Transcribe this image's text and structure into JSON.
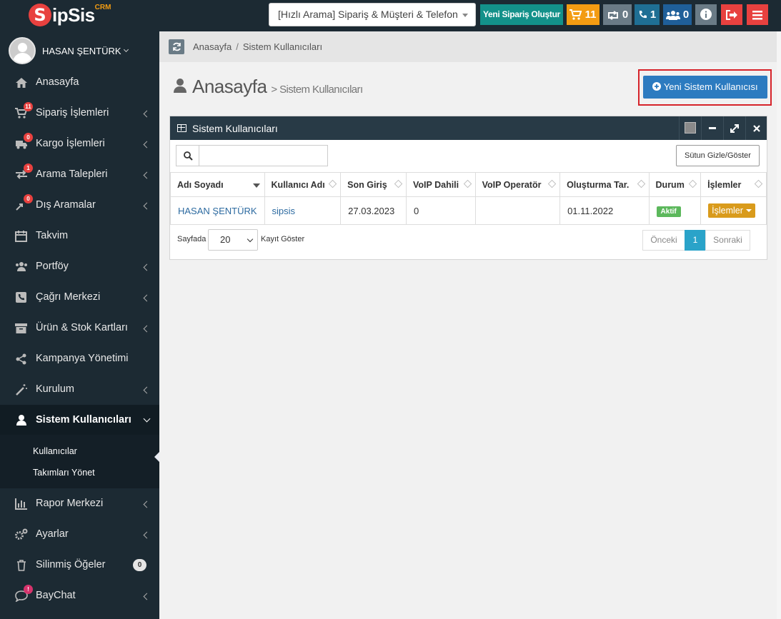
{
  "app": {
    "logo_letter": "S",
    "logo_text": "ipSis",
    "logo_sup": "CRM"
  },
  "topbar": {
    "quick_search": "[Hızlı Arama] Sipariş & Müşteri & Telefon",
    "new_order_label": "Yeni Sipariş Oluştur",
    "cart_count": "11",
    "transfer_count": "0",
    "phone_count": "1",
    "users_count": "0",
    "colors": {
      "orange": "#f39c12",
      "gray": "#6a7b86",
      "teal": "#13918a",
      "blue": "#1f5f99",
      "red": "#e8413f"
    }
  },
  "user": {
    "name": "HASAN ŞENTÜRK"
  },
  "sidebar": {
    "items": [
      {
        "label": "Anasayfa",
        "icon": "home-icon"
      },
      {
        "label": "Sipariş İşlemleri",
        "icon": "cart-icon",
        "badge": "11"
      },
      {
        "label": "Kargo İşlemleri",
        "icon": "truck-icon",
        "badge": "0"
      },
      {
        "label": "Arama Talepleri",
        "icon": "exchange-icon",
        "badge": "1"
      },
      {
        "label": "Dış Aramalar",
        "icon": "outgoing-call-icon",
        "badge": "0"
      },
      {
        "label": "Takvim",
        "icon": "calendar-icon"
      },
      {
        "label": "Portföy",
        "icon": "group-icon"
      },
      {
        "label": "Çağrı Merkezi",
        "icon": "phone-square-icon"
      },
      {
        "label": "Ürün & Stok Kartları",
        "icon": "archive-icon"
      },
      {
        "label": "Kampanya Yönetimi",
        "icon": "share-icon"
      },
      {
        "label": "Kurulum",
        "icon": "magic-wand-icon"
      },
      {
        "label": "Sistem Kullanıcıları",
        "icon": "user-icon"
      },
      {
        "label": "Rapor Merkezi",
        "icon": "bar-chart-icon"
      },
      {
        "label": "Ayarlar",
        "icon": "gears-icon"
      },
      {
        "label": "Silinmiş Öğeler",
        "icon": "trash-icon",
        "count": "0"
      },
      {
        "label": "BayChat",
        "icon": "chat-icon",
        "badge": "!"
      }
    ],
    "submenu": [
      "Kullanıcılar",
      "Takımları Yönet"
    ]
  },
  "breadcrumb": {
    "home": "Anasayfa",
    "sep": "/",
    "current": "Sistem Kullanıcıları"
  },
  "page": {
    "title": "Anasayfa",
    "subtitle": "> Sistem Kullanıcıları",
    "add_button": "Yeni Sistem Kullanıcısı"
  },
  "portlet": {
    "title": "Sistem Kullanıcıları",
    "search_value": "",
    "columns_button": "Sütun Gizle/Göster",
    "columns": [
      "Adı Soyadı",
      "Kullanıcı Adı",
      "Son Giriş",
      "VoIP Dahili",
      "VoIP Operatör",
      "Oluşturma Tar.",
      "Durum",
      "İşlemler"
    ],
    "rows": [
      {
        "name": "HASAN ŞENTÜRK",
        "username": "sipsis",
        "last_login": "27.03.2023",
        "voip_internal": "0",
        "voip_operator": "",
        "created": "01.11.2022",
        "status": "Aktif",
        "actions": "İşlemler"
      }
    ],
    "pager": {
      "prefix": "Sayfada",
      "page_size": "20",
      "suffix": "Kayıt Göster",
      "prev": "Önceki",
      "current": "1",
      "next": "Sonraki"
    }
  }
}
